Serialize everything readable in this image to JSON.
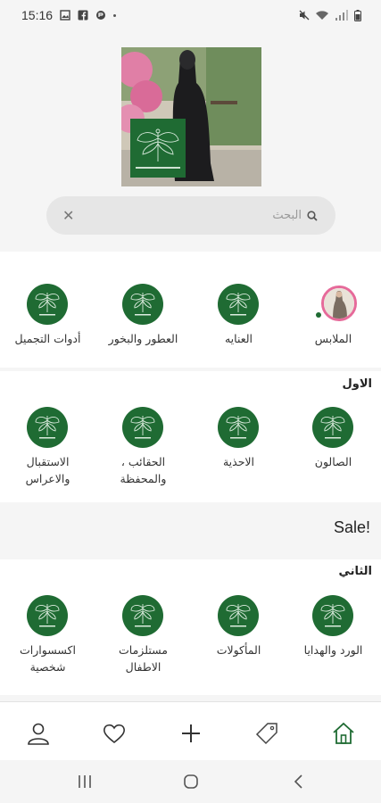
{
  "status_bar": {
    "time": "15:16",
    "icons": [
      "image-icon",
      "facebook-icon",
      "app-icon",
      "mute-icon",
      "wifi-icon",
      "signal-icon",
      "battery-icon"
    ]
  },
  "search": {
    "placeholder": "البحث"
  },
  "top_categories": [
    {
      "label": "الملابس",
      "icon": "profile-story-image"
    },
    {
      "label": "العنايه",
      "icon": "store-logo"
    },
    {
      "label": "العطور والبخور",
      "icon": "store-logo"
    },
    {
      "label": "أدوات التجميل",
      "icon": "store-logo"
    }
  ],
  "section_first": {
    "title": "الاول",
    "items": [
      {
        "label_line1": "الصالون",
        "label_line2": ""
      },
      {
        "label_line1": "الاحذية",
        "label_line2": ""
      },
      {
        "label_line1": "الحقائب ،",
        "label_line2": "والمحفظة"
      },
      {
        "label_line1": "الاستقبال",
        "label_line2": "والاعراس"
      }
    ]
  },
  "sale_banner": {
    "text": "Sale!"
  },
  "section_second": {
    "title": "الثاني",
    "items": [
      {
        "label_line1": "الورد والهدايا",
        "label_line2": ""
      },
      {
        "label_line1": "المأكولات",
        "label_line2": ""
      },
      {
        "label_line1": "مستلزمات",
        "label_line2": "الاطفال"
      },
      {
        "label_line1": "اكسسوارات",
        "label_line2": "شخصية"
      }
    ]
  },
  "bottom_nav": {
    "items": [
      "profile-icon",
      "heart-icon",
      "plus-icon",
      "tag-icon",
      "home-icon"
    ],
    "active": "home-icon"
  },
  "colors": {
    "brand_green": "#1f6b33",
    "background": "#f5f5f5",
    "surface": "#ffffff"
  }
}
